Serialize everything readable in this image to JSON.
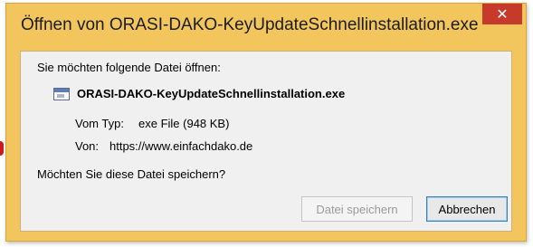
{
  "dialog": {
    "title": "Öffnen von ORASI-DAKO-KeyUpdateSchnellinstallation.exe",
    "close_glyph": "✕",
    "prompt": "Sie möchten folgende Datei öffnen:",
    "file": {
      "icon": "application-file-icon",
      "name": "ORASI-DAKO-KeyUpdateSchnellinstallation.exe",
      "type_label": "Vom Typ:",
      "type_value": "exe File (948 KB)",
      "from_label": "Von:",
      "from_value": "https://www.einfachdako.de"
    },
    "question": "Möchten Sie diese Datei speichern?",
    "buttons": {
      "save": "Datei speichern",
      "cancel": "Abbrechen"
    }
  },
  "colors": {
    "title_bar": "#f2c65c",
    "close_button": "#c7392b",
    "content_bg": "#f0f0f0",
    "focus_border": "#3c7fb1"
  }
}
